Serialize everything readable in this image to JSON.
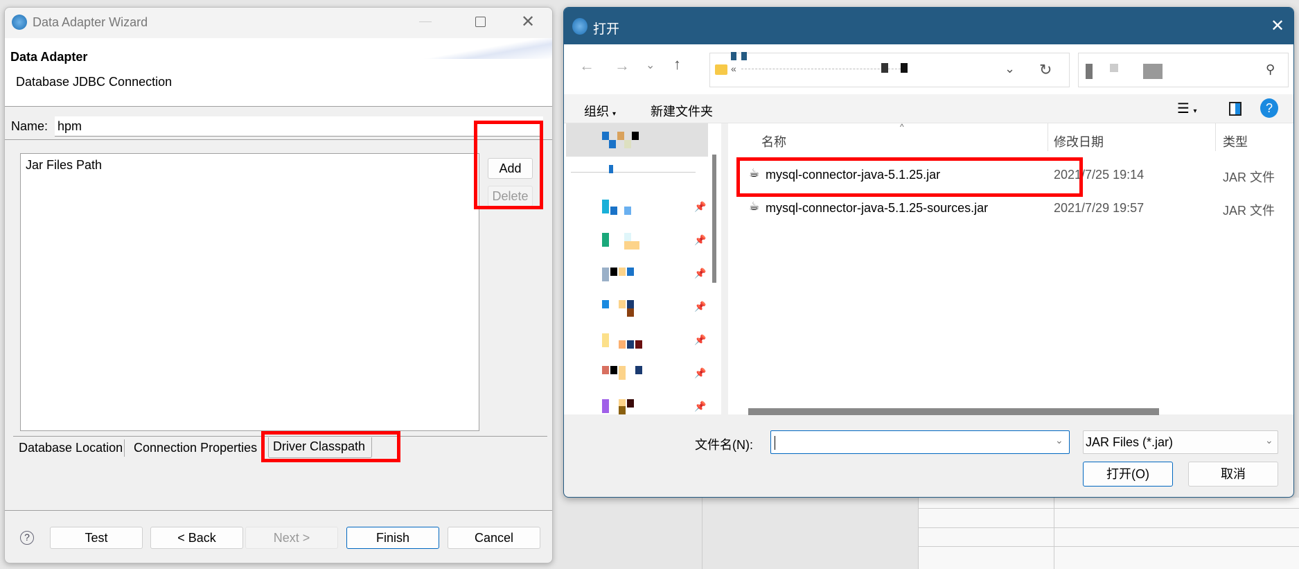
{
  "wizard": {
    "title": "Data Adapter Wizard",
    "header_title": "Data Adapter",
    "header_subtitle": "Database JDBC Connection",
    "name_label": "Name:",
    "name_value": "hpm",
    "list_header": "Jar Files Path",
    "add_label": "Add",
    "delete_label": "Delete",
    "tabs": [
      {
        "label": "Database Location"
      },
      {
        "label": "Connection Properties"
      },
      {
        "label": "Driver Classpath",
        "selected": true
      }
    ],
    "buttons": {
      "test": "Test",
      "back": "< Back",
      "next": "Next >",
      "finish": "Finish",
      "cancel": "Cancel"
    }
  },
  "open_dialog": {
    "title": "打开",
    "toolbar": {
      "organize": "组织",
      "new_folder": "新建文件夹"
    },
    "columns": [
      "名称",
      "修改日期",
      "类型"
    ],
    "files": [
      {
        "name": "mysql-connector-java-5.1.25.jar",
        "modified": "2021/7/25 19:14",
        "type": "JAR 文件",
        "highlighted": true
      },
      {
        "name": "mysql-connector-java-5.1.25-sources.jar",
        "modified": "2021/7/29 19:57",
        "type": "JAR 文件"
      }
    ],
    "filename_label": "文件名(N):",
    "filename_value": "",
    "filter_value": "JAR Files (*.jar)",
    "open_label": "打开(O)",
    "cancel_label": "取消"
  },
  "colors": {
    "highlight": "#ff0000",
    "dialog_titlebar": "#245a82",
    "accent": "#0067c0"
  }
}
